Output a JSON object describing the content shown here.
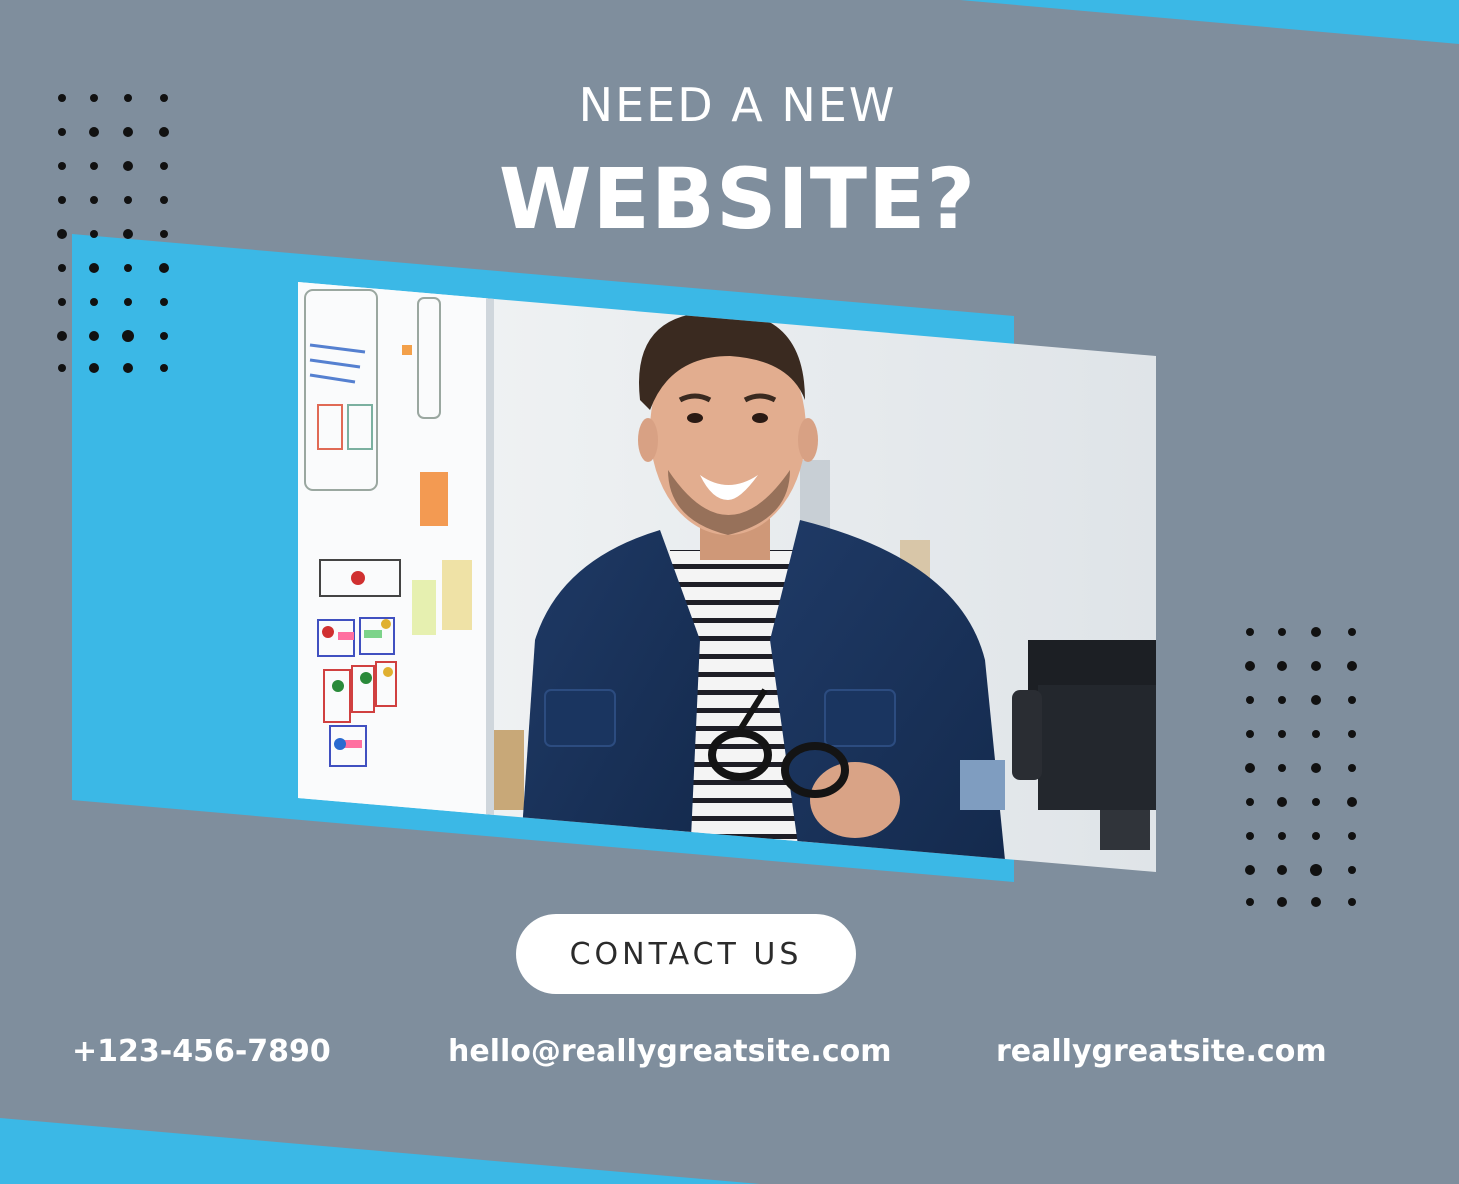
{
  "headline": {
    "line1": "NEED A NEW",
    "line2": "WEBSITE?"
  },
  "cta": {
    "label": "CONTACT US"
  },
  "contacts": {
    "phone": "+123-456-7890",
    "email": "hello@reallygreatsite.com",
    "website": "reallygreatsite.com"
  },
  "colors": {
    "background": "#7f8e9d",
    "accent": "#3bb8e6",
    "text": "#ffffff",
    "button_bg": "#ffffff",
    "button_text": "#2b2b2b",
    "dots": "#111111"
  },
  "photo": {
    "subject": "smiling-man-holding-glasses-photo"
  }
}
